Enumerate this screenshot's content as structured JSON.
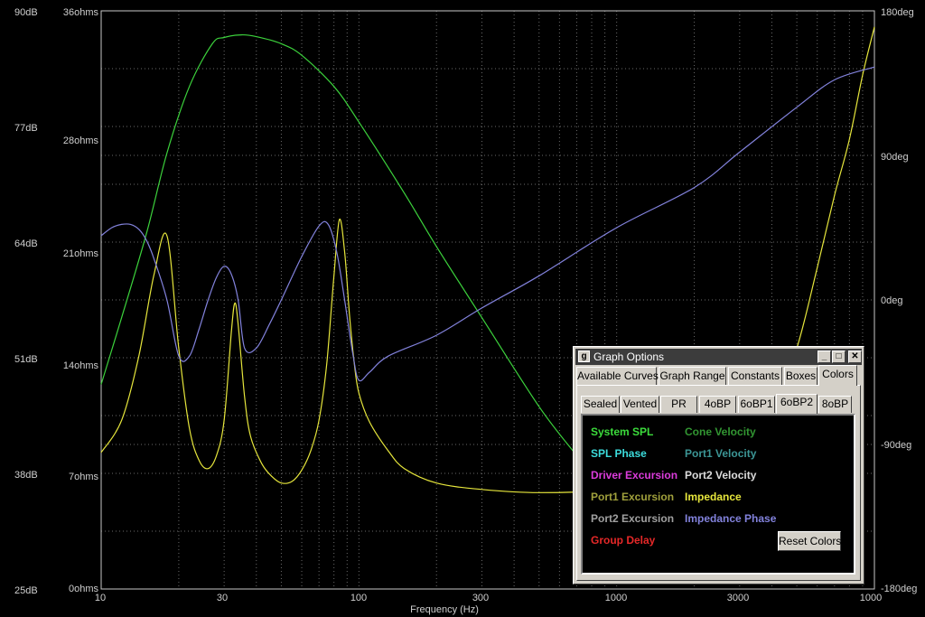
{
  "graph": {
    "x_label": "Frequency (Hz)",
    "x_ticks": [
      "10",
      "30",
      "100",
      "300",
      "1000",
      "3000",
      "1000"
    ],
    "spl_ticks": [
      "90dB",
      "77dB",
      "64dB",
      "51dB",
      "38dB",
      "25dB"
    ],
    "ohm_ticks": [
      "36ohms",
      "28ohms",
      "21ohms",
      "14ohms",
      "7ohms",
      "0ohms"
    ],
    "deg_ticks": [
      "180deg",
      "90deg",
      "0deg",
      "-90deg",
      "-180deg"
    ]
  },
  "chart_data": {
    "type": "line",
    "xlabel": "Frequency (Hz)",
    "x_scale": "log",
    "xlim": [
      10,
      10000
    ],
    "ylim_left_spl": [
      25,
      90
    ],
    "ylim_left_impedance": [
      0,
      36
    ],
    "ylim_right_phase": [
      -180,
      180
    ],
    "grid": true,
    "series": [
      {
        "name": "System SPL",
        "color": "#3cd23c",
        "axis": "spl",
        "x": [
          10,
          12,
          15,
          18,
          22,
          27,
          30,
          35,
          40,
          50,
          60,
          80,
          100,
          150,
          200,
          300,
          500,
          700,
          800
        ],
        "y": [
          48.0,
          55.5,
          65.0,
          74.0,
          81.5,
          86.3,
          87.0,
          87.3,
          87.1,
          86.3,
          85.0,
          81.5,
          77.5,
          69.5,
          63.5,
          55.5,
          45.5,
          40.0,
          38.0
        ]
      },
      {
        "name": "Impedance",
        "color": "#e6e63c",
        "axis": "impedance",
        "x": [
          10,
          12,
          14,
          16,
          18,
          20,
          22,
          24,
          26,
          28,
          30,
          32,
          33,
          34,
          36,
          38,
          42,
          46,
          50,
          55,
          60,
          65,
          70,
          75,
          80,
          84,
          88,
          92,
          96,
          100,
          110,
          130,
          150,
          200,
          300,
          500,
          1000,
          2000,
          3000,
          4000,
          5000,
          6000,
          7000,
          8000,
          9000,
          10000
        ],
        "y": [
          8.5,
          10.5,
          14.5,
          19.5,
          22.0,
          15.0,
          10.0,
          8.0,
          7.5,
          8.3,
          10.5,
          16.0,
          17.8,
          16.5,
          12.0,
          9.5,
          7.8,
          7.0,
          6.6,
          6.7,
          7.4,
          8.6,
          10.5,
          14.0,
          19.5,
          23.0,
          21.0,
          17.0,
          14.0,
          12.2,
          10.4,
          8.6,
          7.5,
          6.6,
          6.2,
          6.0,
          6.2,
          7.0,
          8.0,
          11.0,
          15.0,
          20.0,
          24.5,
          28.0,
          32.0,
          35.0
        ]
      },
      {
        "name": "Impedance Phase",
        "color": "#8282dc",
        "axis": "phase",
        "x": [
          10,
          11,
          12,
          13,
          14,
          15,
          16,
          18,
          20,
          22,
          24,
          26,
          28,
          30,
          32,
          34,
          36,
          40,
          45,
          50,
          60,
          70,
          76,
          82,
          88,
          95,
          100,
          110,
          130,
          200,
          300,
          500,
          1000,
          2000,
          3000,
          5000,
          7000,
          10000
        ],
        "y": [
          40,
          45,
          47,
          47,
          44,
          37,
          26,
          0,
          -35,
          -35,
          -18,
          0,
          14,
          21,
          16,
          0,
          -30,
          -30,
          -15,
          0,
          27,
          46,
          47,
          30,
          0,
          -35,
          -50,
          -45,
          -35,
          -22,
          -5,
          15,
          45,
          70,
          92,
          120,
          137,
          145
        ]
      }
    ]
  },
  "window": {
    "title": "Graph Options",
    "app_icon": "graph-options-icon",
    "min_label": "_",
    "max_label": "□",
    "close_label": "✕",
    "tabs": [
      "Available Curves",
      "Graph Range",
      "Constants",
      "Boxes",
      "Colors"
    ],
    "active_tab": "Colors",
    "subtabs": [
      "Sealed",
      "Vented",
      "PR",
      "4oBP",
      "6oBP1",
      "6oBP2",
      "8oBP"
    ],
    "active_subtab": "6oBP2",
    "colors": {
      "system_spl": {
        "label": "System SPL",
        "color": "#3cdc3c"
      },
      "spl_phase": {
        "label": "SPL Phase",
        "color": "#3cdcdc"
      },
      "driver_excursion": {
        "label": "Driver Excursion",
        "color": "#dc3cdc"
      },
      "port1_excursion": {
        "label": "Port1 Excursion",
        "color": "#a0a03c"
      },
      "port2_excursion": {
        "label": "Port2 Excursion",
        "color": "#a0a0a0"
      },
      "group_delay": {
        "label": "Group Delay",
        "color": "#e62828"
      },
      "cone_velocity": {
        "label": "Cone Velocity",
        "color": "#329632"
      },
      "port1_velocity": {
        "label": "Port1 Velocity",
        "color": "#3c9696"
      },
      "port2_velocity": {
        "label": "Port2 Velocity",
        "color": "#dcdcdc"
      },
      "impedance": {
        "label": "Impedance",
        "color": "#e6e63c"
      },
      "impedance_phase": {
        "label": "Impedance Phase",
        "color": "#8282dc"
      }
    },
    "reset_label": "Reset Colors"
  }
}
